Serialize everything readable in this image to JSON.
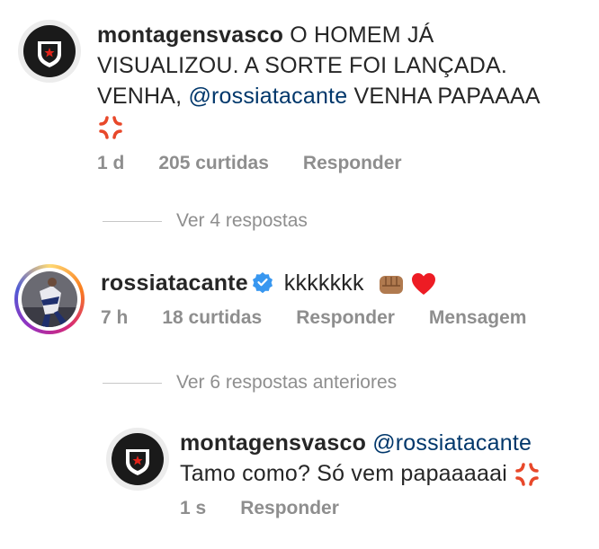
{
  "comments": [
    {
      "username": "montagensvasco",
      "text_before": " O HOMEM JÁ VISUALIZOU. A SORTE FOI LANÇADA. VENHA, ",
      "mention": "@rossiatacante",
      "text_after": " VENHA PAPAAAA",
      "emoji": "anger-symbol",
      "time": "1 d",
      "likes": "205 curtidas",
      "reply": "Responder"
    },
    {
      "username": "rossiatacante",
      "verified": true,
      "text": "kkkkkkk",
      "emoji": [
        "fist-bump",
        "red-heart"
      ],
      "time": "7 h",
      "likes": "18 curtidas",
      "reply": "Responder",
      "message": "Mensagem"
    },
    {
      "username": "montagensvasco",
      "mention": "@rossiatacante",
      "text": "Tamo como? Só vem papaaaaai",
      "emoji": "anger-symbol",
      "time": "1 s",
      "reply": "Responder"
    }
  ],
  "threads": {
    "view_replies_1": "Ver 4 respostas",
    "view_replies_2": "Ver 6 respostas anteriores"
  },
  "colors": {
    "mention": "#00376b",
    "meta": "#8e8e8e",
    "verified": "#3897f0",
    "heart": "#ed1c24",
    "anger": "#e8482a"
  }
}
